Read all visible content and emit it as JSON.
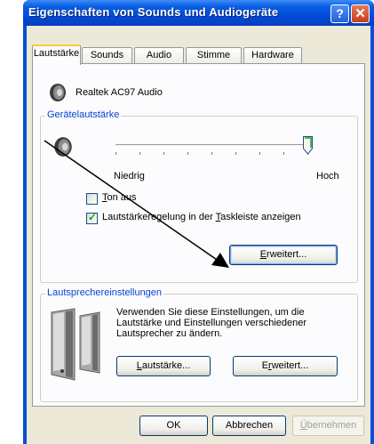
{
  "window": {
    "title": "Eigenschaften von Sounds und Audiogeräte",
    "help_glyph": "?",
    "close_glyph": "✕"
  },
  "tabs": [
    {
      "label": "Lautstärke",
      "active": true
    },
    {
      "label": "Sounds",
      "active": false
    },
    {
      "label": "Audio",
      "active": false
    },
    {
      "label": "Stimme",
      "active": false
    },
    {
      "label": "Hardware",
      "active": false
    }
  ],
  "device": {
    "name": "Realtek AC97 Audio"
  },
  "device_volume": {
    "group_label": "Gerätelautstärke",
    "low_label": "Niedrig",
    "high_label": "Hoch",
    "level": 1.0,
    "mute": {
      "label_prefix": "T",
      "label_rest": "on aus",
      "checked": false
    },
    "taskbar": {
      "label_before": "Lautstärkeregelung in der ",
      "label_ul": "T",
      "label_after": "askleiste anzeigen",
      "checked": true
    },
    "advanced_button": {
      "ul": "E",
      "rest": "rweitert..."
    }
  },
  "speaker_settings": {
    "group_label": "Lautsprechereinstellungen",
    "description": "Verwenden Sie diese Einstellungen, um die Lautstärke und Einstellungen verschiedener Lautsprecher zu ändern.",
    "volume_button": {
      "ul": "L",
      "rest": "autstärke..."
    },
    "advanced_button": {
      "before": "E",
      "ul": "r",
      "rest": "weitert..."
    }
  },
  "footer": {
    "ok": "OK",
    "cancel": "Abbrechen",
    "apply_ul": "Ü",
    "apply_rest": "bernehmen"
  },
  "colors": {
    "titlebar": "#0a4fd8",
    "dialog_bg": "#ece9d8",
    "group_label": "#0046d5",
    "check": "#21a121"
  }
}
